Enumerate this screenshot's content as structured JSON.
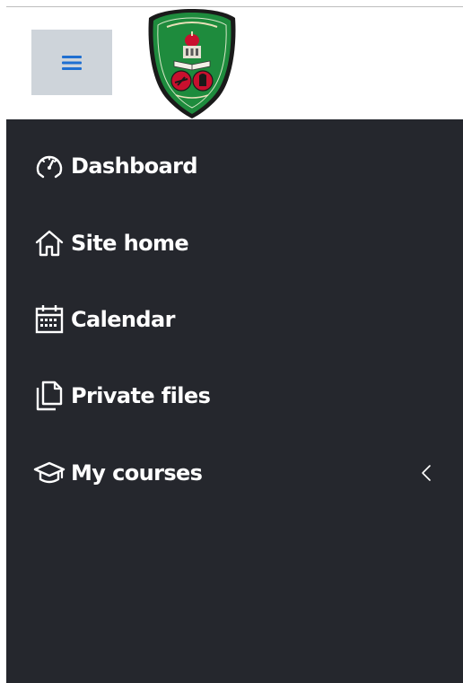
{
  "header": {
    "menu_toggle_icon": "hamburger-icon",
    "logo_icon": "university-crest-logo",
    "logo_colors": {
      "shield_green": "#1e8b3d",
      "shield_border": "#1a1a1a",
      "emblem_red": "#c8102e"
    }
  },
  "sidebar": {
    "background": "#25272d",
    "items": [
      {
        "label": "Dashboard",
        "icon": "dashboard-gauge-icon"
      },
      {
        "label": "Site home",
        "icon": "home-icon"
      },
      {
        "label": "Calendar",
        "icon": "calendar-icon"
      },
      {
        "label": "Private files",
        "icon": "file-icon"
      },
      {
        "label": "My courses",
        "icon": "graduation-cap-icon",
        "expandable_icon": "chevron-left-icon"
      }
    ]
  },
  "colors": {
    "accent": "#1f6fd1",
    "toggle_bg": "#ced4da"
  }
}
